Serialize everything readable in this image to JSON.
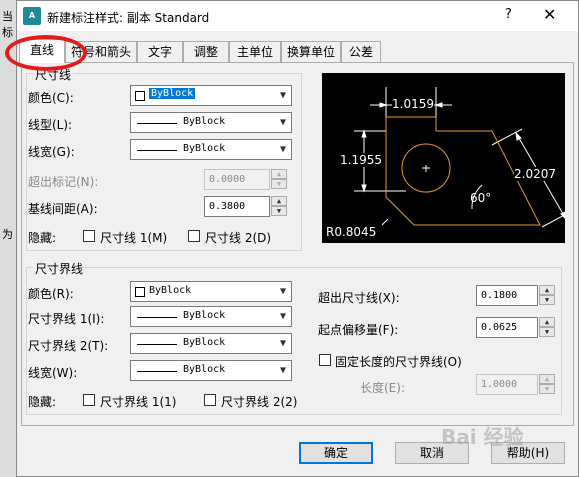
{
  "background": {
    "line1": "当",
    "line2": "标",
    "line3": "为"
  },
  "window": {
    "title": "新建标注样式: 副本 Standard",
    "help": "?",
    "close": "✕",
    "icon": "A"
  },
  "tabs": [
    "直线",
    "符号和箭头",
    "文字",
    "调整",
    "主单位",
    "换算单位",
    "公差"
  ],
  "dim_lines": {
    "title": "尺寸线",
    "color_label": "颜色(C):",
    "color_value": "ByBlock",
    "linetype_label": "线型(L):",
    "linetype_value": "ByBlock",
    "lineweight_label": "线宽(G):",
    "lineweight_value": "ByBlock",
    "extend_label": "超出标记(N):",
    "extend_value": "0.0000",
    "baseline_label": "基线间距(A):",
    "baseline_value": "0.3800",
    "suppress_label": "隐藏:",
    "suppress1": "尺寸线 1(M)",
    "suppress2": "尺寸线 2(D)"
  },
  "ext_lines": {
    "title": "尺寸界线",
    "color_label": "颜色(R):",
    "color_value": "ByBlock",
    "ext1_label": "尺寸界线 1(I):",
    "ext1_value": "ByBlock",
    "ext2_label": "尺寸界线 2(T):",
    "ext2_value": "ByBlock",
    "lineweight_label": "线宽(W):",
    "lineweight_value": "ByBlock",
    "suppress_label": "隐藏:",
    "suppress1": "尺寸界线 1(1)",
    "suppress2": "尺寸界线 2(2)",
    "beyond_label": "超出尺寸线(X):",
    "beyond_value": "0.1800",
    "offset_label": "起点偏移量(F):",
    "offset_value": "0.0625",
    "fixed_label": "固定长度的尺寸界线(O)",
    "length_label": "长度(E):",
    "length_value": "1.0000"
  },
  "preview": {
    "d1": "1.0159",
    "d2": "1.1955",
    "d3": "2.0207",
    "angle": "60°",
    "radius": "R0.8045",
    "center": "+"
  },
  "buttons": {
    "ok": "确定",
    "cancel": "取消",
    "help": "帮助(H)"
  },
  "watermark": "Bai 经验",
  "colors": {
    "preview_bg": "#000000",
    "shape": "#e39a2c",
    "dim": "#ffffff",
    "accent": "#0078d7",
    "highlight": "#e31b1b"
  },
  "icons": {
    "dropdown": "chevron-down-icon",
    "spin": "spinner-arrows-icon"
  }
}
